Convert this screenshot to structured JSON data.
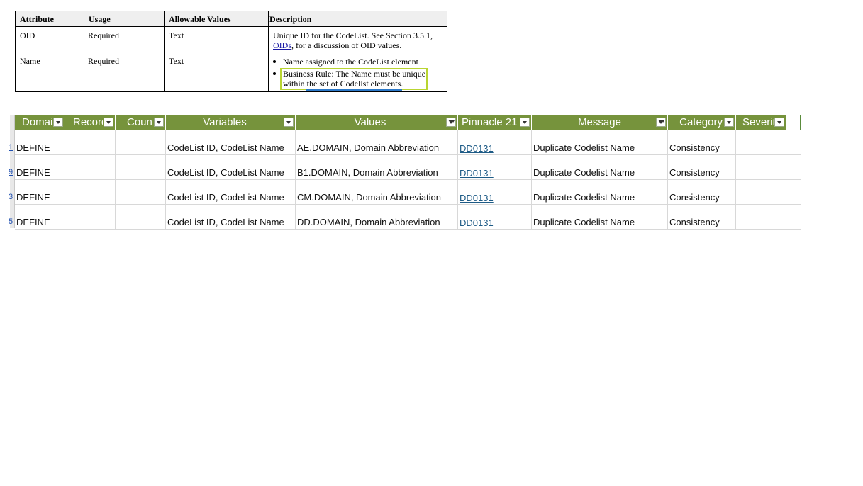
{
  "spec_table": {
    "headers": [
      "Attribute",
      "Usage",
      "Allowable Values",
      "Description"
    ],
    "rows": [
      {
        "attribute": "OID",
        "usage": "Required",
        "allowable": "Text",
        "desc_line1": "Unique ID for the CodeList. See Section 3.5.1,",
        "desc_link": "OIDs",
        "desc_line2_rest": ", for a discussion of OID values."
      },
      {
        "attribute": "Name",
        "usage": "Required",
        "allowable": "Text",
        "bullet1": "Name assigned to the CodeList element",
        "bullet2_line1": "Business Rule: The Name must be unique",
        "bullet2_line2": "within the set of Codelist elements."
      }
    ]
  },
  "sheet": {
    "headers": [
      "Domai",
      "Record",
      "Count",
      "Variables",
      "Values",
      "Pinnacle 21",
      "Message",
      "Category",
      "Severit"
    ],
    "filtered_columns": [
      "Values",
      "Message"
    ],
    "header_color": "#76933c",
    "row_numbers": [
      "1",
      "9",
      "3",
      "5"
    ],
    "rows": [
      {
        "domain": "DEFINE",
        "record": "",
        "count": "",
        "variables": "CodeList ID, CodeList Name",
        "values": "AE.DOMAIN, Domain Abbreviation",
        "pinnacle": "DD0131",
        "message": "Duplicate Codelist Name",
        "category": "Consistency",
        "severity": ""
      },
      {
        "domain": "DEFINE",
        "record": "",
        "count": "",
        "variables": "CodeList ID, CodeList Name",
        "values": "B1.DOMAIN, Domain Abbreviation",
        "pinnacle": "DD0131",
        "message": "Duplicate Codelist Name",
        "category": "Consistency",
        "severity": ""
      },
      {
        "domain": "DEFINE",
        "record": "",
        "count": "",
        "variables": "CodeList ID, CodeList Name",
        "values": "CM.DOMAIN, Domain Abbreviation",
        "pinnacle": "DD0131",
        "message": "Duplicate Codelist Name",
        "category": "Consistency",
        "severity": ""
      },
      {
        "domain": "DEFINE",
        "record": "",
        "count": "",
        "variables": "CodeList ID, CodeList Name",
        "values": "DD.DOMAIN, Domain Abbreviation",
        "pinnacle": "DD0131",
        "message": "Duplicate Codelist Name",
        "category": "Consistency",
        "severity": ""
      }
    ]
  }
}
